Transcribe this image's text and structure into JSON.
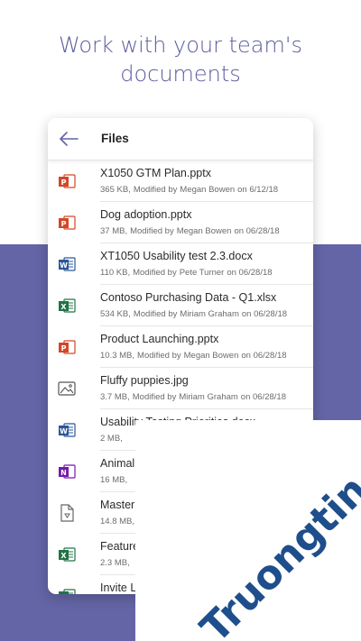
{
  "headline": {
    "line1": "Work with your team's",
    "line2": "documents"
  },
  "appbar": {
    "title": "Files"
  },
  "files": [
    {
      "name": "X1050 GTM Plan.pptx",
      "size": "365 KB,",
      "modified_label": "Modified by",
      "person": "Megan Bowen",
      "date": "on 6/12/18",
      "type": "ppt"
    },
    {
      "name": "Dog adoption.pptx",
      "size": "37 MB,",
      "modified_label": "Modified by",
      "person": "Megan Bowen",
      "date": "on 06/28/18",
      "type": "ppt"
    },
    {
      "name": "XT1050 Usability test 2.3.docx",
      "size": "110 KB,",
      "modified_label": "Modified by",
      "person": "Pete Turner",
      "date": "on 06/28/18",
      "type": "word"
    },
    {
      "name": "Contoso Purchasing Data - Q1.xlsx",
      "size": "534 KB,",
      "modified_label": "Modified by",
      "person": "Miriam Graham",
      "date": "on 06/28/18",
      "type": "excel"
    },
    {
      "name": "Product Launching.pptx",
      "size": "10.3 MB,",
      "modified_label": "Modified by",
      "person": "Megan Bowen",
      "date": "on 06/28/18",
      "type": "ppt"
    },
    {
      "name": "Fluffy puppies.jpg",
      "size": "3.7 MB,",
      "modified_label": "Modified by",
      "person": "Miriam Graham",
      "date": "on 06/28/18",
      "type": "image"
    },
    {
      "name": "Usability Testing Priorities.docx",
      "size": "2 MB,",
      "modified_label": "",
      "person": "",
      "date": "",
      "type": "word"
    },
    {
      "name": "Animal",
      "size": "16 MB,",
      "modified_label": "",
      "person": "",
      "date": "",
      "type": "onenote"
    },
    {
      "name": "Master",
      "size": "14.8 MB,",
      "modified_label": "",
      "person": "",
      "date": "",
      "type": "generic"
    },
    {
      "name": "Feature",
      "size": "2.3 MB,",
      "modified_label": "",
      "person": "",
      "date": "",
      "type": "excel"
    },
    {
      "name": "Invite L",
      "size": "",
      "modified_label": "",
      "person": "",
      "date": "",
      "type": "excel"
    }
  ],
  "icon_colors": {
    "ppt": "#d24726",
    "word": "#2b579a",
    "excel": "#217346",
    "onenote": "#7719aa",
    "generic": "#666666",
    "image": "#555555"
  },
  "watermark": {
    "text": "Truongtin.top",
    "color": "#1e4e8c",
    "accent": "#f07b1d"
  }
}
